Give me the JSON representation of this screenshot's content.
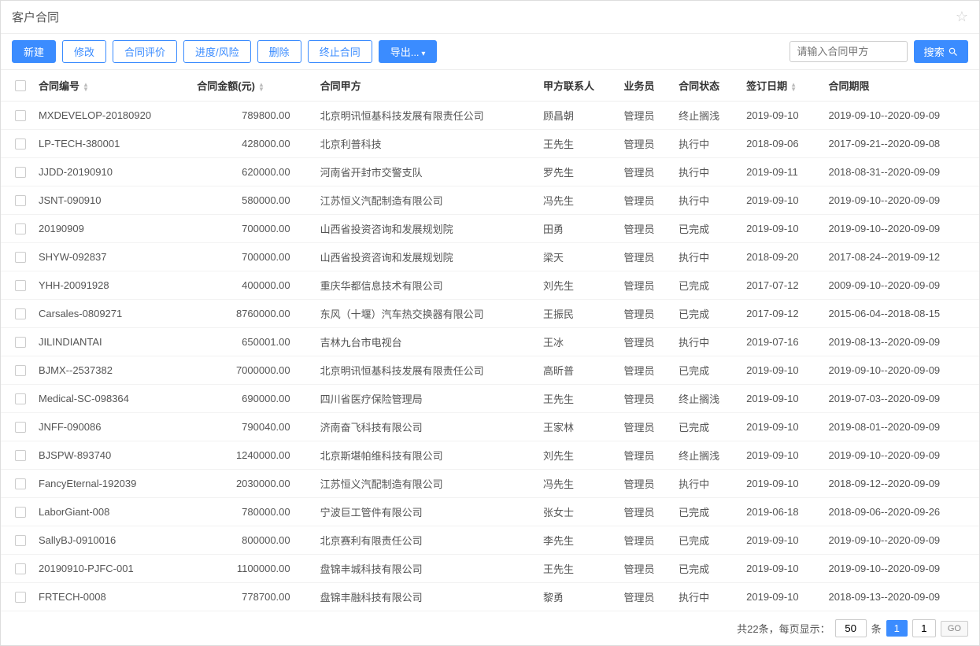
{
  "title": "客户合同",
  "toolbar": {
    "new": "新建",
    "edit": "修改",
    "evaluate": "合同评价",
    "progress": "进度/风险",
    "delete": "删除",
    "terminate": "终止合同",
    "export": "导出..."
  },
  "search": {
    "placeholder": "请输入合同甲方",
    "button": "搜索"
  },
  "columns": {
    "code": "合同编号",
    "amount": "合同金额(元)",
    "partyA": "合同甲方",
    "contact": "甲方联系人",
    "sales": "业务员",
    "status": "合同状态",
    "signDate": "签订日期",
    "period": "合同期限"
  },
  "rows": [
    {
      "code": "MXDEVELOP-20180920",
      "amount": "789800.00",
      "partyA": "北京明讯恒基科技发展有限责任公司",
      "contact": "顾昌朝",
      "sales": "管理员",
      "status": "终止搁浅",
      "signDate": "2019-09-10",
      "period": "2019-09-10--2020-09-09"
    },
    {
      "code": "LP-TECH-380001",
      "amount": "428000.00",
      "partyA": "北京利普科技",
      "contact": "王先生",
      "sales": "管理员",
      "status": "执行中",
      "signDate": "2018-09-06",
      "period": "2017-09-21--2020-09-08"
    },
    {
      "code": "JJDD-20190910",
      "amount": "620000.00",
      "partyA": "河南省开封市交警支队",
      "contact": "罗先生",
      "sales": "管理员",
      "status": "执行中",
      "signDate": "2019-09-11",
      "period": "2018-08-31--2020-09-09"
    },
    {
      "code": "JSNT-090910",
      "amount": "580000.00",
      "partyA": "江苏恒义汽配制造有限公司",
      "contact": "冯先生",
      "sales": "管理员",
      "status": "执行中",
      "signDate": "2019-09-10",
      "period": "2019-09-10--2020-09-09"
    },
    {
      "code": "20190909",
      "amount": "700000.00",
      "partyA": "山西省投资咨询和发展规划院",
      "contact": "田勇",
      "sales": "管理员",
      "status": "已完成",
      "signDate": "2019-09-10",
      "period": "2019-09-10--2020-09-09"
    },
    {
      "code": "SHYW-092837",
      "amount": "700000.00",
      "partyA": "山西省投资咨询和发展规划院",
      "contact": "梁天",
      "sales": "管理员",
      "status": "执行中",
      "signDate": "2018-09-20",
      "period": "2017-08-24--2019-09-12"
    },
    {
      "code": "YHH-20091928",
      "amount": "400000.00",
      "partyA": "重庆华都信息技术有限公司",
      "contact": "刘先生",
      "sales": "管理员",
      "status": "已完成",
      "signDate": "2017-07-12",
      "period": "2009-09-10--2020-09-09"
    },
    {
      "code": "Carsales-0809271",
      "amount": "8760000.00",
      "partyA": "东风（十堰）汽车热交换器有限公司",
      "contact": "王振民",
      "sales": "管理员",
      "status": "已完成",
      "signDate": "2017-09-12",
      "period": "2015-06-04--2018-08-15"
    },
    {
      "code": "JILINDIANTAI",
      "amount": "650001.00",
      "partyA": "吉林九台市电视台",
      "contact": "王冰",
      "sales": "管理员",
      "status": "执行中",
      "signDate": "2019-07-16",
      "period": "2019-08-13--2020-09-09"
    },
    {
      "code": "BJMX--2537382",
      "amount": "7000000.00",
      "partyA": "北京明讯恒基科技发展有限责任公司",
      "contact": "高昕普",
      "sales": "管理员",
      "status": "已完成",
      "signDate": "2019-09-10",
      "period": "2019-09-10--2020-09-09"
    },
    {
      "code": "Medical-SC-098364",
      "amount": "690000.00",
      "partyA": "四川省医疗保险管理局",
      "contact": "王先生",
      "sales": "管理员",
      "status": "终止搁浅",
      "signDate": "2019-09-10",
      "period": "2019-07-03--2020-09-09"
    },
    {
      "code": "JNFF-090086",
      "amount": "790040.00",
      "partyA": "济南奋飞科技有限公司",
      "contact": "王家林",
      "sales": "管理员",
      "status": "已完成",
      "signDate": "2019-09-10",
      "period": "2019-08-01--2020-09-09"
    },
    {
      "code": "BJSPW-893740",
      "amount": "1240000.00",
      "partyA": "北京斯堪帕维科技有限公司",
      "contact": "刘先生",
      "sales": "管理员",
      "status": "终止搁浅",
      "signDate": "2019-09-10",
      "period": "2019-09-10--2020-09-09"
    },
    {
      "code": "FancyEternal-192039",
      "amount": "2030000.00",
      "partyA": "江苏恒义汽配制造有限公司",
      "contact": "冯先生",
      "sales": "管理员",
      "status": "执行中",
      "signDate": "2019-09-10",
      "period": "2018-09-12--2020-09-09"
    },
    {
      "code": "LaborGiant-008",
      "amount": "780000.00",
      "partyA": "宁波巨工管件有限公司",
      "contact": "张女士",
      "sales": "管理员",
      "status": "已完成",
      "signDate": "2019-06-18",
      "period": "2018-09-06--2020-09-26"
    },
    {
      "code": "SallyBJ-0910016",
      "amount": "800000.00",
      "partyA": "北京赛利有限责任公司",
      "contact": "李先生",
      "sales": "管理员",
      "status": "已完成",
      "signDate": "2019-09-10",
      "period": "2019-09-10--2020-09-09"
    },
    {
      "code": "20190910-PJFC-001",
      "amount": "1100000.00",
      "partyA": "盘锦丰城科技有限公司",
      "contact": "王先生",
      "sales": "管理员",
      "status": "已完成",
      "signDate": "2019-09-10",
      "period": "2019-09-10--2020-09-09"
    },
    {
      "code": "FRTECH-0008",
      "amount": "778700.00",
      "partyA": "盘锦丰融科技有限公司",
      "contact": "黎勇",
      "sales": "管理员",
      "status": "执行中",
      "signDate": "2019-09-10",
      "period": "2018-09-13--2020-09-09"
    }
  ],
  "pagination": {
    "totalLabel": "共22条，每页显示：",
    "pageSize": "50",
    "unit": "条",
    "currentPage": "1",
    "gotoPage": "1",
    "goLabel": "GO"
  }
}
